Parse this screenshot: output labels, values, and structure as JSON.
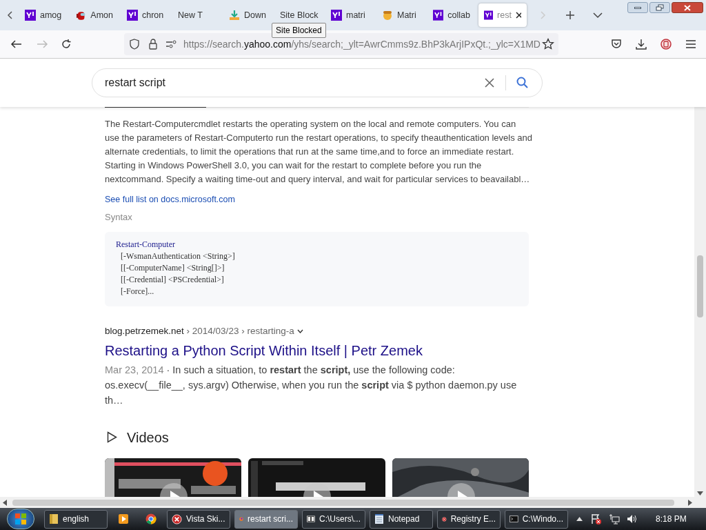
{
  "tabs": [
    {
      "label": "amog",
      "kind": "yahoo",
      "selected": false
    },
    {
      "label": "Amon",
      "kind": "crewmate",
      "selected": false
    },
    {
      "label": "chron",
      "kind": "yahoo",
      "selected": false
    },
    {
      "label": "New T",
      "kind": "plain",
      "selected": false
    },
    {
      "label": "Down",
      "kind": "download",
      "selected": false
    },
    {
      "label": "Site Block",
      "kind": "plain",
      "selected": false
    },
    {
      "label": "matri",
      "kind": "yahoo",
      "selected": false
    },
    {
      "label": "Matri",
      "kind": "cartoon",
      "selected": false
    },
    {
      "label": "collab",
      "kind": "yahoo",
      "selected": false
    },
    {
      "label": "rest",
      "kind": "yahoo",
      "selected": true
    }
  ],
  "tooltip": "Site Blocked",
  "address": {
    "prefix": "https://search.",
    "domain": "yahoo.com",
    "rest": "/yhs/search;_ylt=AwrCmms9z.BhP3kArjIPxQt.;_ylc=X1MD"
  },
  "search": {
    "value": "restart script"
  },
  "result_1": {
    "description": "The Restart-Computercmdlet restarts the operating system on the local and remote computers. You can use the parameters of Restart-Computerto run the restart operations, to specify theauthentication levels and alternate credentials, to limit the operations that run at the same time,and to force an immediate restart. Starting in Windows PowerShell 3.0, you can wait for the restart to complete before you run the nextcommand. Specify a waiting time-out and query interval, and wait for particular services to beavailabl…",
    "link": "See full list on docs.microsoft.com",
    "section": "Syntax",
    "code": [
      "Restart-Computer",
      "[-WsmanAuthentication <String>]",
      "[[-ComputerName] <String[]>]",
      "[[-Credential] <PSCredential>]",
      "[-Force]..."
    ]
  },
  "result_2": {
    "site": "blog.petrzemek.net",
    "path": " › 2014/03/23 › restarting-a",
    "title": "Restarting a Python Script Within Itself | Petr Zemek",
    "date": "Mar 23, 2014",
    "snippet": " · In such a situation, to **restart** the **script,** use the following code: os.execv(__file__, sys.argv) Otherwise, when you run the **script** via $ python daemon.py use th…"
  },
  "videos": {
    "heading": "Videos"
  },
  "taskbar": {
    "items": [
      {
        "label": "english",
        "kind": "folder",
        "selected": false
      },
      {
        "kind": "media"
      },
      {
        "kind": "chrome"
      },
      {
        "label": "Vista Ski...",
        "kind": "error",
        "selected": false
      },
      {
        "label": "restart scri...",
        "kind": "firefox",
        "selected": true
      },
      {
        "label": "C:\\Users\\...",
        "kind": "zip",
        "selected": false
      },
      {
        "label": "Notepad",
        "kind": "notepad",
        "selected": false
      },
      {
        "label": "Registry E...",
        "kind": "error",
        "selected": false
      },
      {
        "label": "C:\\Windo...",
        "kind": "cmd",
        "selected": false
      }
    ],
    "clock": "8:18 PM"
  }
}
